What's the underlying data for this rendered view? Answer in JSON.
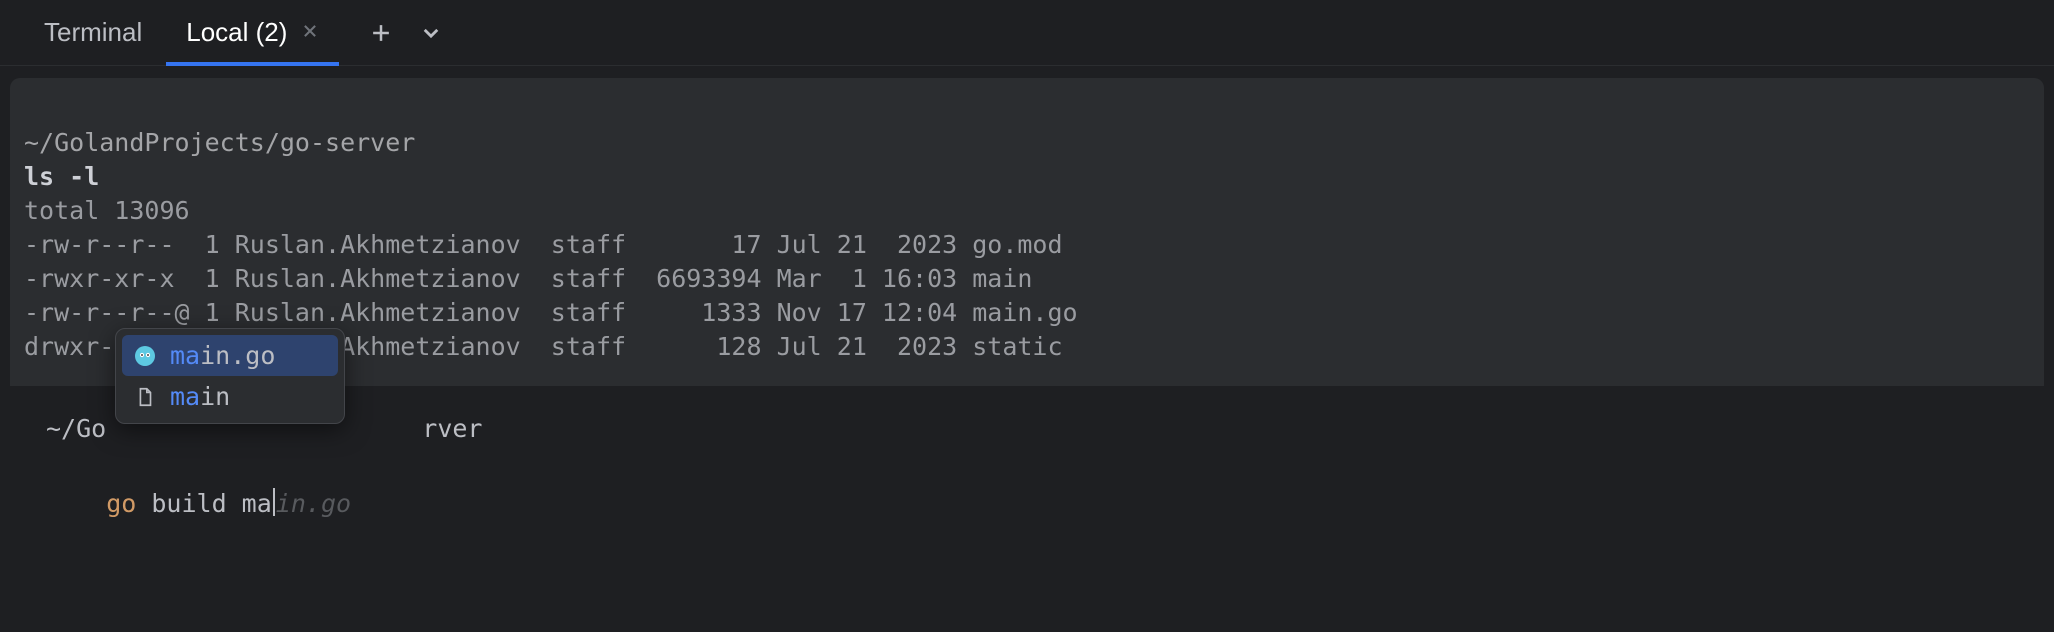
{
  "tabs": {
    "terminal": "Terminal",
    "active": "Local (2)"
  },
  "output": {
    "cwd": "~/GolandProjects/go-server",
    "cmd": "ls -l",
    "lines": {
      "0": "total 13096",
      "1": "-rw-r--r--  1 Ruslan.Akhmetzianov  staff       17 Jul 21  2023 go.mod",
      "2": "-rwxr-xr-x  1 Ruslan.Akhmetzianov  staff  6693394 Mar  1 16:03 main",
      "3": "-rw-r--r--@ 1 Ruslan.Akhmetzianov  staff     1333 Nov 17 12:04 main.go",
      "4": "drwxr-xr-x  4 Ruslan.Akhmetzianov  staff      128 Jul 21  2023 static"
    }
  },
  "prompt": {
    "cwd_masked": "~/Go                     rver",
    "cmd_go": "go",
    "cmd_rest": " build ma",
    "ghost": "in.go"
  },
  "completions": {
    "0": {
      "match": "ma",
      "rest": "in.go"
    },
    "1": {
      "match": "ma",
      "rest": "in"
    }
  }
}
